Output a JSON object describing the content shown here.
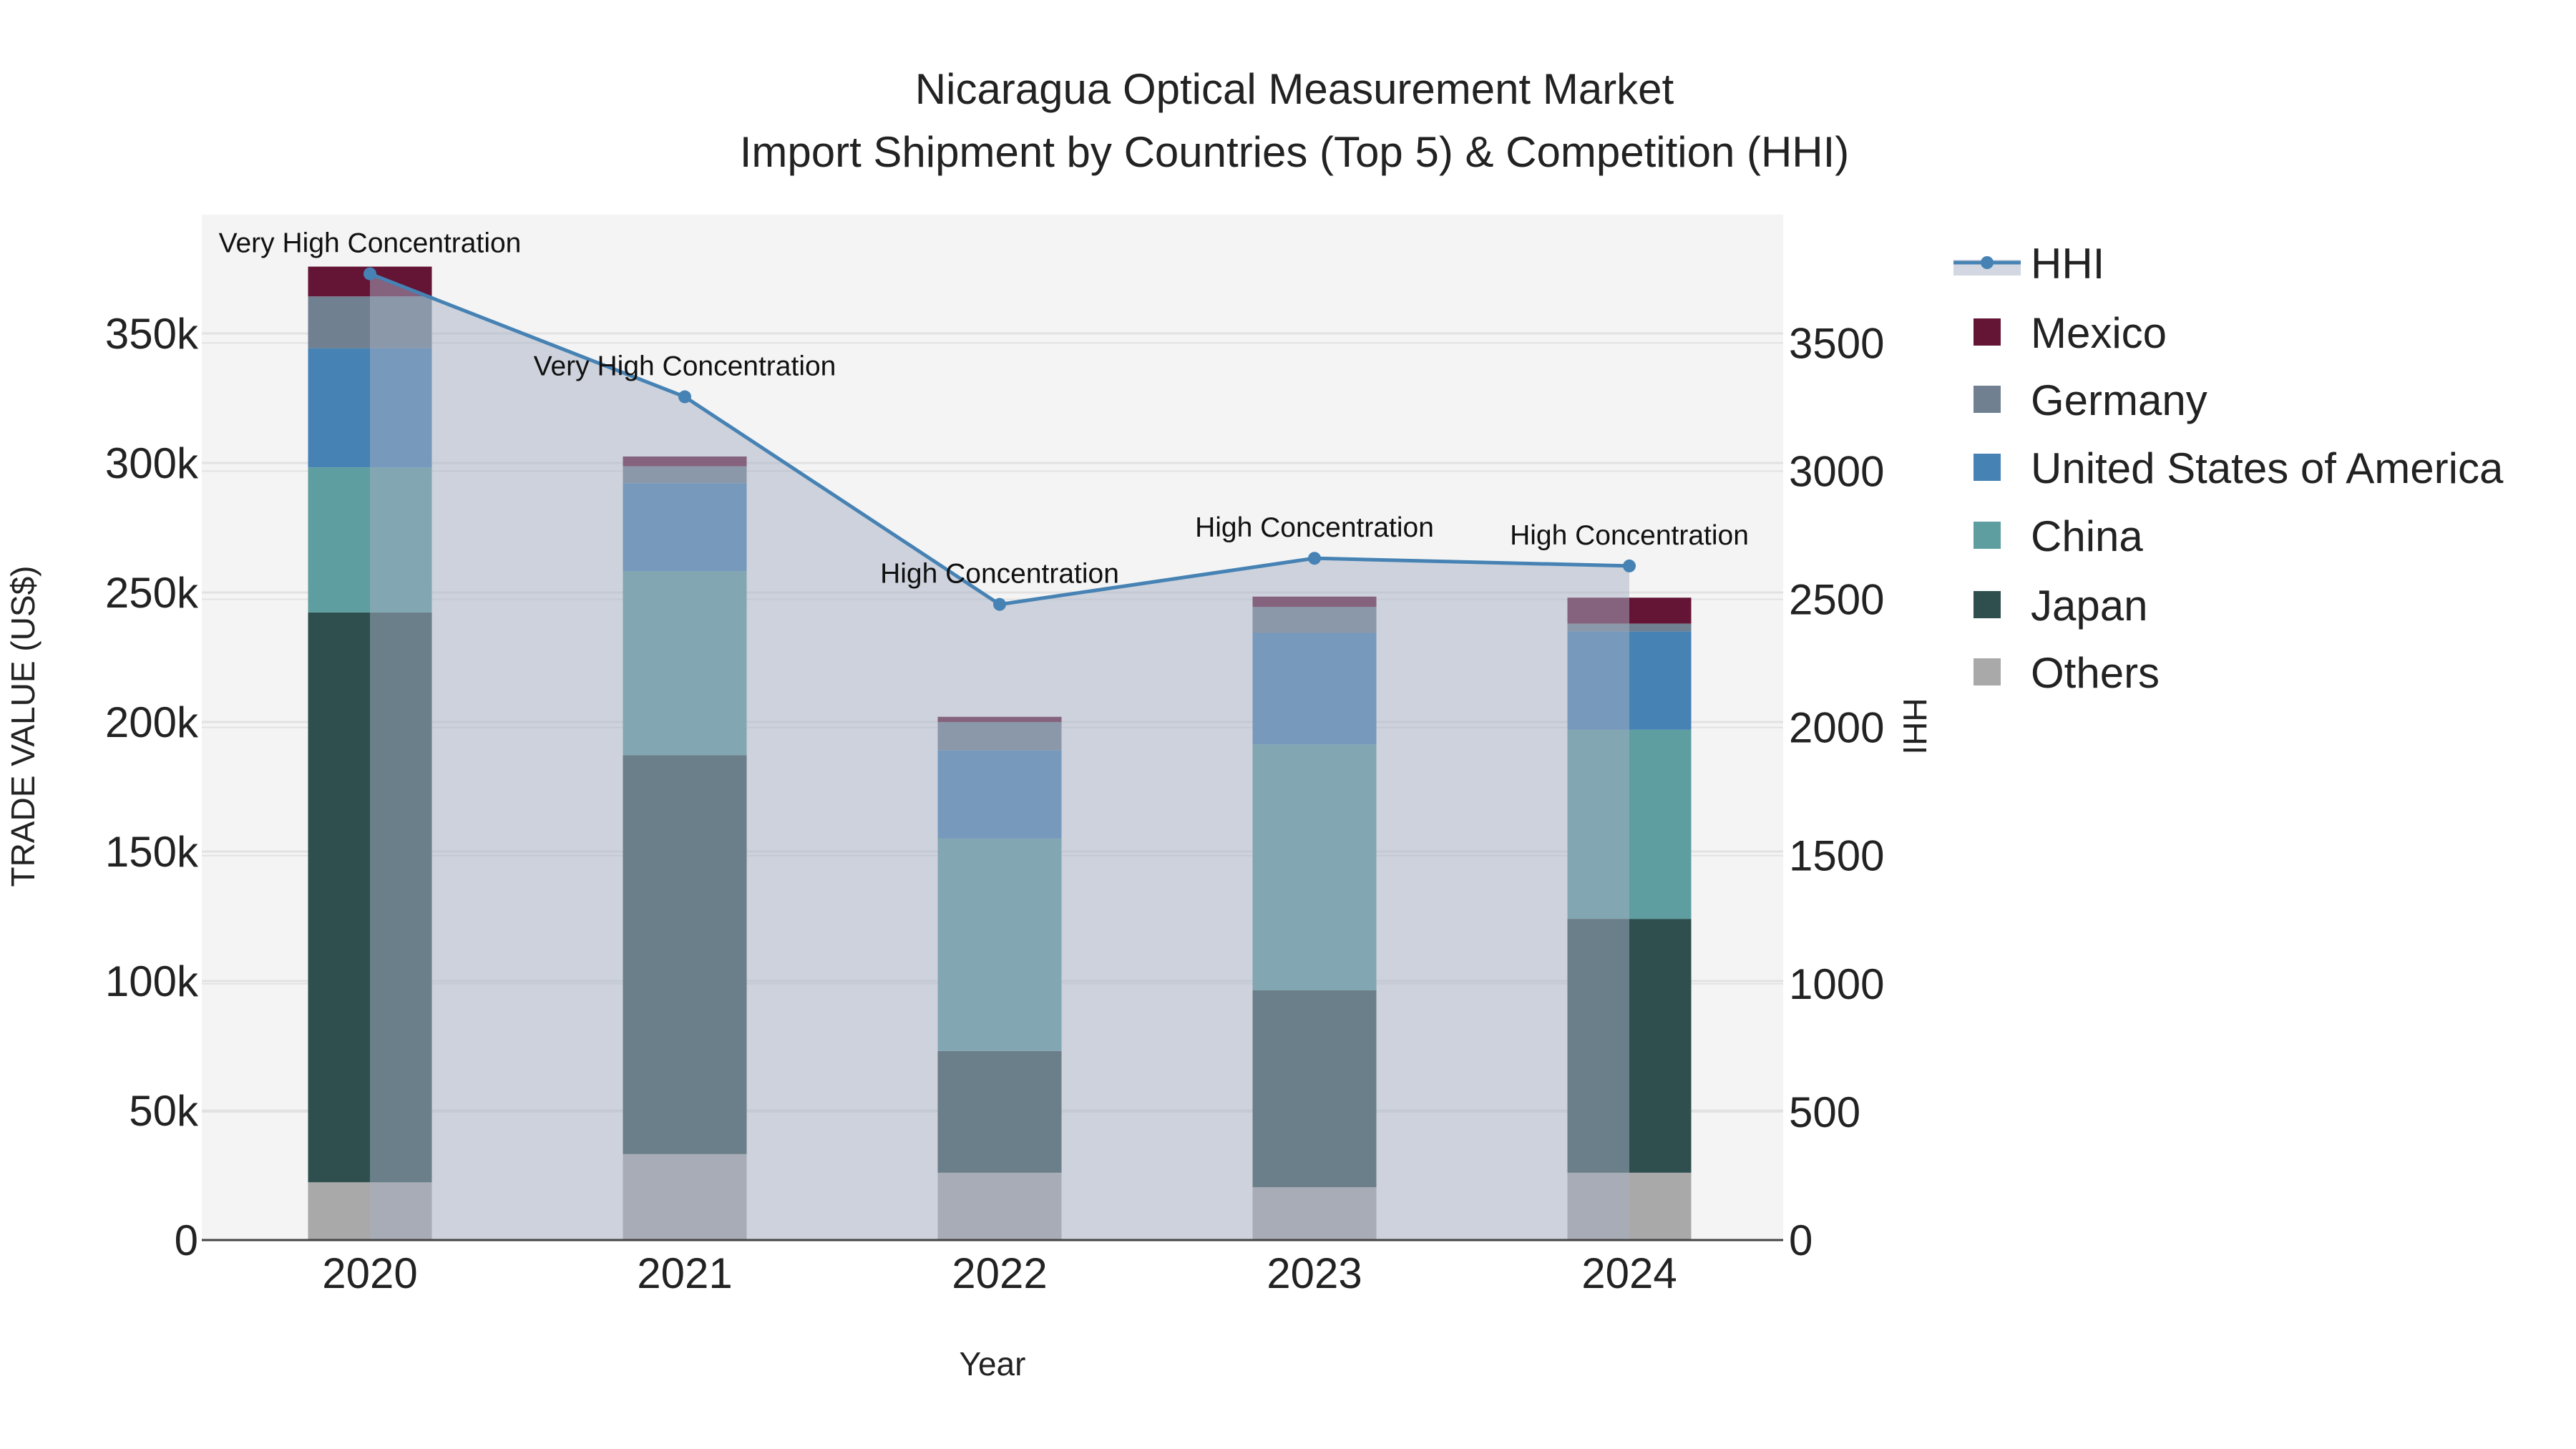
{
  "chart_data": {
    "type": "bar",
    "title": "Nicaragua Optical Measurement Market",
    "subtitle": "Import Shipment by Countries (Top 5) & Competition (HHI)",
    "xlabel": "Year",
    "ylabel": "TRADE VALUE (US$)",
    "y2label": "HHI",
    "categories": [
      "2020",
      "2021",
      "2022",
      "2023",
      "2024"
    ],
    "ylim": [
      0,
      385000
    ],
    "y2lim": [
      0,
      3950
    ],
    "yticks": [
      0,
      50000,
      100000,
      150000,
      200000,
      250000,
      300000,
      350000
    ],
    "ytick_labels": [
      "0",
      "50k",
      "100k",
      "150k",
      "200k",
      "250k",
      "300k",
      "350k"
    ],
    "y2ticks": [
      0,
      500,
      1000,
      1500,
      2000,
      2500,
      3000,
      3500
    ],
    "y2tick_labels": [
      "0",
      "500",
      "1000",
      "1500",
      "2000",
      "2500",
      "3000",
      "3500"
    ],
    "grid": true,
    "legend_placement": "right",
    "stacked": true,
    "series": [
      {
        "name": "Others",
        "color": "#A9A9A9",
        "values": [
          22300,
          33200,
          26000,
          20400,
          26000
        ]
      },
      {
        "name": "Japan",
        "color": "#2F4F4F",
        "values": [
          220000,
          154000,
          47000,
          76000,
          98000
        ]
      },
      {
        "name": "China",
        "color": "#5F9EA0",
        "values": [
          56000,
          71000,
          82000,
          95000,
          73000
        ]
      },
      {
        "name": "United States of America",
        "color": "#4682B4",
        "values": [
          46000,
          34000,
          34000,
          43000,
          38000
        ]
      },
      {
        "name": "Germany",
        "color": "#708090",
        "values": [
          20000,
          6500,
          11000,
          10000,
          3000
        ]
      },
      {
        "name": "Mexico",
        "color": "#641536",
        "values": [
          11500,
          3800,
          2000,
          4000,
          10000
        ]
      }
    ],
    "line_series": {
      "name": "HHI",
      "color": "#4682B4",
      "axis": "right",
      "values": [
        3770,
        3290,
        2480,
        2660,
        2630
      ],
      "annotations": [
        "Very High Concentration",
        "Very High Concentration",
        "High Concentration",
        "High Concentration",
        "High Concentration"
      ]
    },
    "legend_order": [
      "HHI",
      "Mexico",
      "Germany",
      "United States of America",
      "China",
      "Japan",
      "Others"
    ]
  }
}
